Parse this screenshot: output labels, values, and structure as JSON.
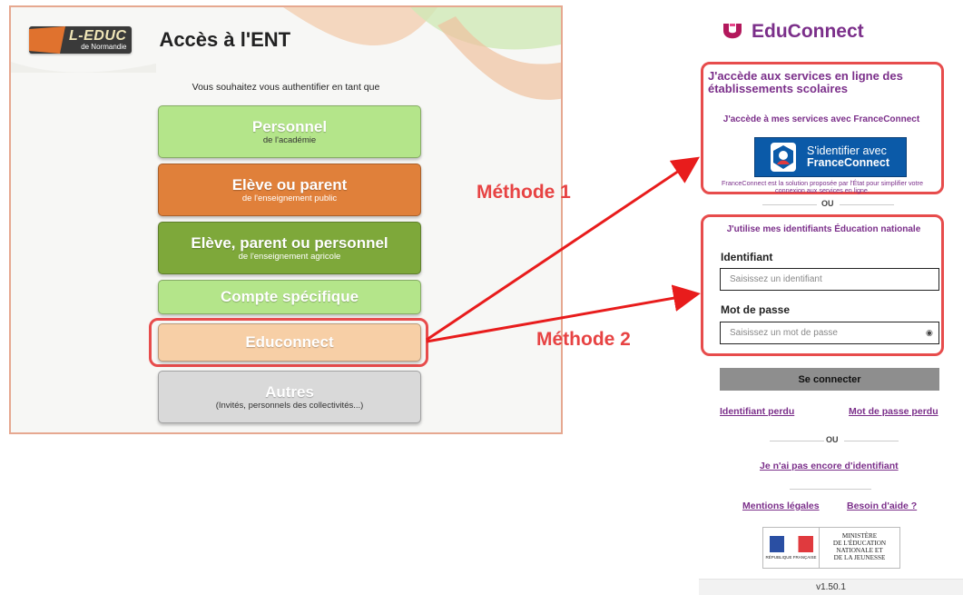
{
  "ent": {
    "logo_main": "L-EDUC",
    "logo_sub": "de Normandie",
    "title": "Accès à l'ENT",
    "prompt": "Vous souhaitez vous authentifier en tant que",
    "options": [
      {
        "label": "Personnel",
        "sub": "de l'académie"
      },
      {
        "label": "Elève ou parent",
        "sub": "de l'enseignement public"
      },
      {
        "label": "Elève, parent ou personnel",
        "sub": "de l'enseignement agricole"
      },
      {
        "label": "Compte spécifique",
        "sub": ""
      },
      {
        "label": "Educonnect",
        "sub": ""
      },
      {
        "label": "Autres",
        "sub": "(Invités, personnels des collectivités...)"
      }
    ]
  },
  "annotations": {
    "method1": "Méthode 1",
    "method2": "Méthode 2",
    "highlight_color": "#e74c4c"
  },
  "educonnect": {
    "brand": "EduConnect",
    "brand_color": "#7b2f8a",
    "fc_heading": "J'accède aux services en ligne des établissements scolaires",
    "fc_sub": "J'accède à mes services avec FranceConnect",
    "fc_button_line1": "S'identifier avec",
    "fc_button_line2": "FranceConnect",
    "fc_note": "FranceConnect est la solution proposée par l'État pour simplifier votre connexion aux services en ligne.",
    "or1": "OU",
    "id_heading": "J'utilise mes identifiants Éducation nationale",
    "identifiant_label": "Identifiant",
    "identifiant_placeholder": "Saisissez un identifiant",
    "password_label": "Mot de passe",
    "password_placeholder": "Saisissez un mot de passe",
    "submit": "Se connecter",
    "lost_id": "Identifiant perdu",
    "lost_password": "Mot de passe perdu",
    "or2": "OU",
    "no_id": "Je n'ai pas encore d'identifiant",
    "legal": "Mentions légales",
    "help": "Besoin d'aide ?",
    "republic": "RÉPUBLIQUE FRANÇAISE",
    "ministry_lines": [
      "MINISTÈRE",
      "DE L'ÉDUCATION",
      "NATIONALE ET",
      "DE LA JEUNESSE"
    ],
    "version": "v1.50.1"
  }
}
